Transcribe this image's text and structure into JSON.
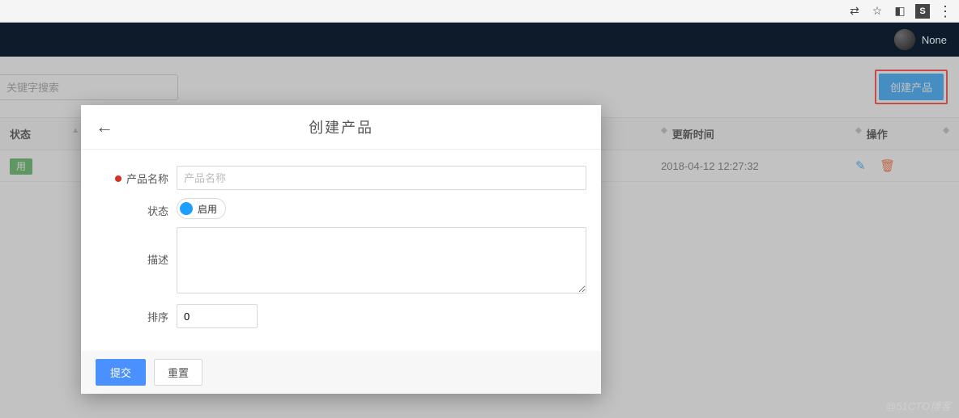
{
  "chrome": {
    "icons": [
      "translate-icon",
      "star-icon",
      "extension-icon",
      "s-badge",
      "more-icon"
    ],
    "s_letter": "S"
  },
  "navbar": {
    "username": "None"
  },
  "toolbar": {
    "search_placeholder": "关键字搜索",
    "create_button": "创建产品"
  },
  "table": {
    "headers": {
      "status": "状态",
      "update_time": "更新时间",
      "actions": "操作"
    },
    "rows": [
      {
        "status_text": "用",
        "update_time": "2018-04-12 12:27:32"
      }
    ]
  },
  "modal": {
    "title": "创建产品",
    "fields": {
      "name_label": "产品名称",
      "name_placeholder": "产品名称",
      "status_label": "状态",
      "status_toggle_text": "启用",
      "desc_label": "描述",
      "sort_label": "排序",
      "sort_value": "0"
    },
    "buttons": {
      "submit": "提交",
      "reset": "重置"
    }
  },
  "watermark": "@51CTO博客"
}
